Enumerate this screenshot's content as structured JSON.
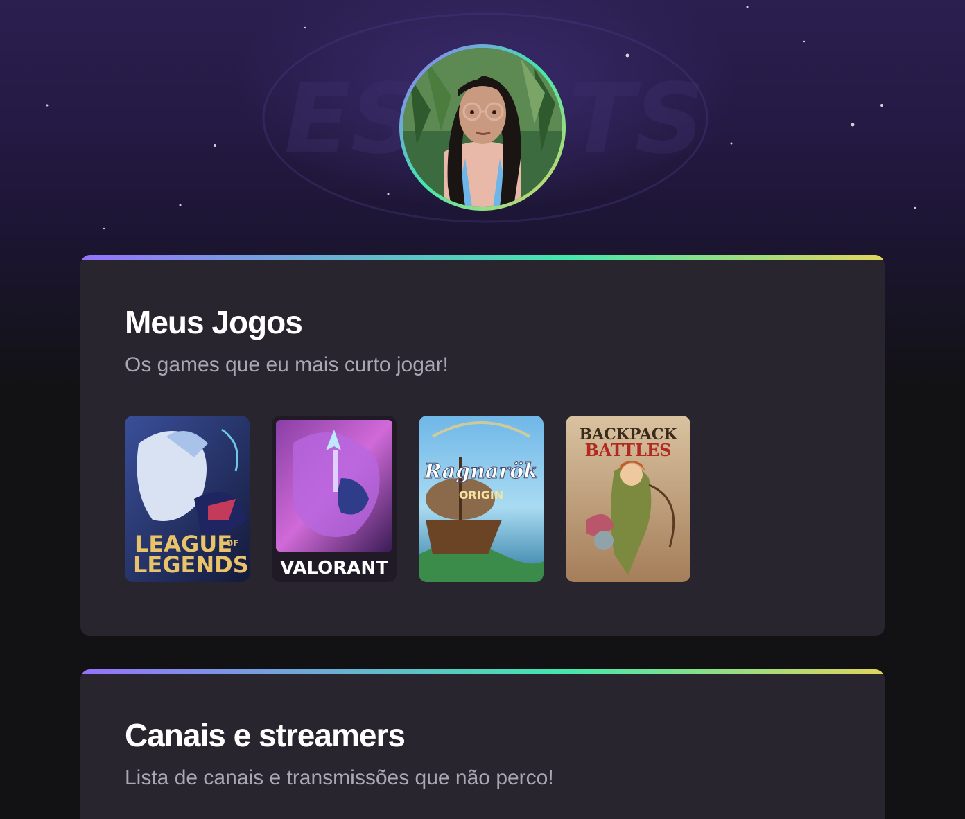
{
  "profile": {
    "avatar_alt": "avatar"
  },
  "games_section": {
    "title": "Meus Jogos",
    "subtitle": "Os games que eu mais curto jogar!",
    "games": [
      {
        "name": "League of Legends",
        "logo_line1": "LEAGUE",
        "logo_of": "OF",
        "logo_line2": "LEGENDS"
      },
      {
        "name": "Valorant",
        "logo": "VALORANT"
      },
      {
        "name": "Ragnarok Origin",
        "logo": "Ragnarök",
        "logo_sub": "ORIGIN"
      },
      {
        "name": "Backpack Battles",
        "logo_line1": "BACKPACK",
        "logo_line2": "BATTLES"
      }
    ]
  },
  "channels_section": {
    "title": "Canais e streamers",
    "subtitle": "Lista de canais e transmissões que não perco!"
  },
  "colors": {
    "gradient": [
      "#9572fc",
      "#43e7ad",
      "#e2d45c"
    ],
    "card_bg": "#29252f",
    "page_bg": "#121214"
  }
}
